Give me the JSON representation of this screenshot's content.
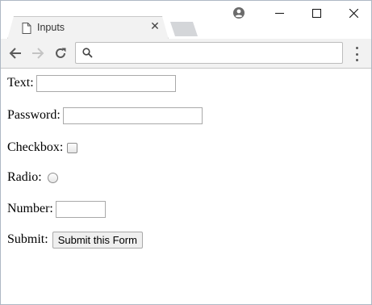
{
  "browser": {
    "tab": {
      "title": "Inputs",
      "close_glyph": "✕"
    },
    "omnibox": {
      "value": "",
      "placeholder": ""
    }
  },
  "form": {
    "text_label": "Text:",
    "text_value": "",
    "password_label": "Password:",
    "password_value": "",
    "checkbox_label": "Checkbox:",
    "checkbox_checked": false,
    "radio_label": "Radio:",
    "radio_checked": false,
    "number_label": "Number:",
    "number_value": "",
    "submit_label": "Submit:",
    "submit_button": "Submit this Form"
  },
  "colors": {
    "tab_bg": "#f2f2f2",
    "toolbar_bg": "#f2f2f2",
    "window_border": "#aeb8c4"
  },
  "icons": {
    "tab": "document-icon",
    "profile": "account-circle-icon",
    "minimize": "minimize-icon",
    "maximize": "maximize-icon",
    "close": "close-icon",
    "back": "back-arrow-icon",
    "forward": "forward-arrow-icon",
    "reload": "reload-icon",
    "search": "search-icon",
    "menu": "kebab-menu-icon"
  }
}
